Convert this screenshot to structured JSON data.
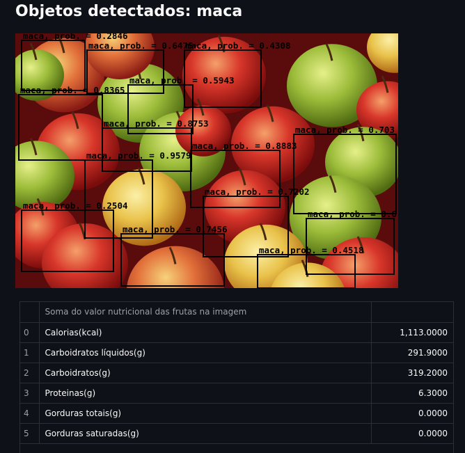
{
  "page": {
    "title": "Objetos detectados: maca"
  },
  "image": {
    "detections": [
      {
        "label": "maca, prob. = 0.2846"
      },
      {
        "label": "maca, prob. = 0.6475"
      },
      {
        "label": "maca, prob. = 0.4308"
      },
      {
        "label": "maca, prob. = 0.5943"
      },
      {
        "label": "maca, prob. = 0.8365"
      },
      {
        "label": "maca, prob. = 0.8753"
      },
      {
        "label": "maca, prob. = 0.703"
      },
      {
        "label": "maca, prob. = 0.9579"
      },
      {
        "label": "maca, prob. = 0.8883"
      },
      {
        "label": "maca, prob. = 0.7202"
      },
      {
        "label": "maca, prob. = 0.2504"
      },
      {
        "label": "maca, prob. = 0.6"
      },
      {
        "label": "maca, prob. = 0.7456"
      },
      {
        "label": "maca, prob. = 0.4518"
      }
    ]
  },
  "table": {
    "header": "Soma do valor nutricional das frutas na imagem",
    "rows": [
      {
        "index": "0",
        "name": "Calorias(kcal)",
        "value": "1,113.0000"
      },
      {
        "index": "1",
        "name": "Carboidratos líquidos(g)",
        "value": "291.9000"
      },
      {
        "index": "2",
        "name": "Carboidratos(g)",
        "value": "319.2000"
      },
      {
        "index": "3",
        "name": "Proteinas(g)",
        "value": "6.3000"
      },
      {
        "index": "4",
        "name": "Gorduras totais(g)",
        "value": "0.0000"
      },
      {
        "index": "5",
        "name": "Gorduras saturadas(g)",
        "value": "0.0000"
      }
    ]
  }
}
